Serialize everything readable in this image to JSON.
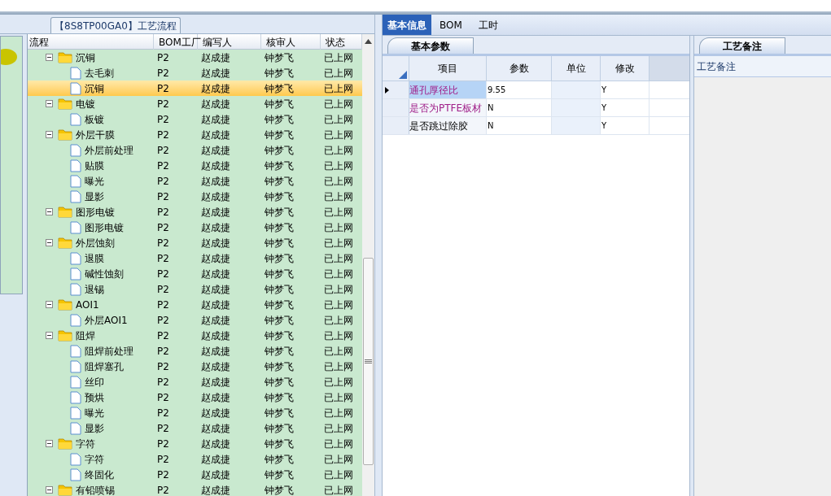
{
  "flow_panel": {
    "title": "【8S8TP00GA0】工艺流程",
    "columns": [
      "流程",
      "BOM工厂",
      "编写人",
      "核审人",
      "状态"
    ],
    "tree": [
      {
        "name": "沉铜",
        "bom": "P2",
        "writer": "赵成捷",
        "reviewer": "钟梦飞",
        "status": "已上网",
        "expanded": true,
        "selected": false,
        "children": [
          {
            "name": "去毛刺",
            "bom": "P2",
            "writer": "赵成捷",
            "reviewer": "钟梦飞",
            "status": "已上网",
            "selected": false
          },
          {
            "name": "沉铜",
            "bom": "P2",
            "writer": "赵成捷",
            "reviewer": "钟梦飞",
            "status": "已上网",
            "selected": true
          }
        ]
      },
      {
        "name": "电镀",
        "bom": "P2",
        "writer": "赵成捷",
        "reviewer": "钟梦飞",
        "status": "已上网",
        "expanded": true,
        "selected": false,
        "children": [
          {
            "name": "板镀",
            "bom": "P2",
            "writer": "赵成捷",
            "reviewer": "钟梦飞",
            "status": "已上网",
            "selected": false
          }
        ]
      },
      {
        "name": "外层干膜",
        "bom": "P2",
        "writer": "赵成捷",
        "reviewer": "钟梦飞",
        "status": "已上网",
        "expanded": true,
        "selected": false,
        "children": [
          {
            "name": "外层前处理",
            "bom": "P2",
            "writer": "赵成捷",
            "reviewer": "钟梦飞",
            "status": "已上网",
            "selected": false
          },
          {
            "name": "贴膜",
            "bom": "P2",
            "writer": "赵成捷",
            "reviewer": "钟梦飞",
            "status": "已上网",
            "selected": false
          },
          {
            "name": "曝光",
            "bom": "P2",
            "writer": "赵成捷",
            "reviewer": "钟梦飞",
            "status": "已上网",
            "selected": false
          },
          {
            "name": "显影",
            "bom": "P2",
            "writer": "赵成捷",
            "reviewer": "钟梦飞",
            "status": "已上网",
            "selected": false
          }
        ]
      },
      {
        "name": "图形电镀",
        "bom": "P2",
        "writer": "赵成捷",
        "reviewer": "钟梦飞",
        "status": "已上网",
        "expanded": true,
        "selected": false,
        "children": [
          {
            "name": "图形电镀",
            "bom": "P2",
            "writer": "赵成捷",
            "reviewer": "钟梦飞",
            "status": "已上网",
            "selected": false
          }
        ]
      },
      {
        "name": "外层蚀刻",
        "bom": "P2",
        "writer": "赵成捷",
        "reviewer": "钟梦飞",
        "status": "已上网",
        "expanded": true,
        "selected": false,
        "children": [
          {
            "name": "退膜",
            "bom": "P2",
            "writer": "赵成捷",
            "reviewer": "钟梦飞",
            "status": "已上网",
            "selected": false
          },
          {
            "name": "碱性蚀刻",
            "bom": "P2",
            "writer": "赵成捷",
            "reviewer": "钟梦飞",
            "status": "已上网",
            "selected": false
          },
          {
            "name": "退锡",
            "bom": "P2",
            "writer": "赵成捷",
            "reviewer": "钟梦飞",
            "status": "已上网",
            "selected": false
          }
        ]
      },
      {
        "name": "AOI1",
        "bom": "P2",
        "writer": "赵成捷",
        "reviewer": "钟梦飞",
        "status": "已上网",
        "expanded": true,
        "selected": false,
        "children": [
          {
            "name": "外层AOI1",
            "bom": "P2",
            "writer": "赵成捷",
            "reviewer": "钟梦飞",
            "status": "已上网",
            "selected": false
          }
        ]
      },
      {
        "name": "阻焊",
        "bom": "P2",
        "writer": "赵成捷",
        "reviewer": "钟梦飞",
        "status": "已上网",
        "expanded": true,
        "selected": false,
        "children": [
          {
            "name": "阻焊前处理",
            "bom": "P2",
            "writer": "赵成捷",
            "reviewer": "钟梦飞",
            "status": "已上网",
            "selected": false
          },
          {
            "name": "阻焊塞孔",
            "bom": "P2",
            "writer": "赵成捷",
            "reviewer": "钟梦飞",
            "status": "已上网",
            "selected": false
          },
          {
            "name": "丝印",
            "bom": "P2",
            "writer": "赵成捷",
            "reviewer": "钟梦飞",
            "status": "已上网",
            "selected": false
          },
          {
            "name": "预烘",
            "bom": "P2",
            "writer": "赵成捷",
            "reviewer": "钟梦飞",
            "status": "已上网",
            "selected": false
          },
          {
            "name": "曝光",
            "bom": "P2",
            "writer": "赵成捷",
            "reviewer": "钟梦飞",
            "status": "已上网",
            "selected": false
          },
          {
            "name": "显影",
            "bom": "P2",
            "writer": "赵成捷",
            "reviewer": "钟梦飞",
            "status": "已上网",
            "selected": false
          }
        ]
      },
      {
        "name": "字符",
        "bom": "P2",
        "writer": "赵成捷",
        "reviewer": "钟梦飞",
        "status": "已上网",
        "expanded": true,
        "selected": false,
        "children": [
          {
            "name": "字符",
            "bom": "P2",
            "writer": "赵成捷",
            "reviewer": "钟梦飞",
            "status": "已上网",
            "selected": false
          },
          {
            "name": "终固化",
            "bom": "P2",
            "writer": "赵成捷",
            "reviewer": "钟梦飞",
            "status": "已上网",
            "selected": false
          }
        ]
      },
      {
        "name": "有铅喷锡",
        "bom": "P2",
        "writer": "赵成捷",
        "reviewer": "钟梦飞",
        "status": "已上网",
        "expanded": true,
        "selected": false
      }
    ]
  },
  "tabs": [
    {
      "label": "基本信息",
      "selected": true
    },
    {
      "label": "BOM",
      "selected": false
    },
    {
      "label": "工时",
      "selected": false
    }
  ],
  "params_panel": {
    "tab": "基本参数",
    "columns": [
      "项目",
      "参数",
      "单位",
      "修改"
    ],
    "rows": [
      {
        "item": "通孔厚径比",
        "value": "9.55",
        "modified": "Y",
        "highlighted": true,
        "selected": true
      },
      {
        "item": "是否为PTFE板材",
        "value": "N",
        "modified": "Y",
        "highlighted": true,
        "selected": false
      },
      {
        "item": "是否跳过除胶",
        "value": "N",
        "modified": "Y",
        "highlighted": false,
        "selected": false
      }
    ]
  },
  "notes_panel": {
    "tab": "工艺备注",
    "label": "工艺备注"
  }
}
